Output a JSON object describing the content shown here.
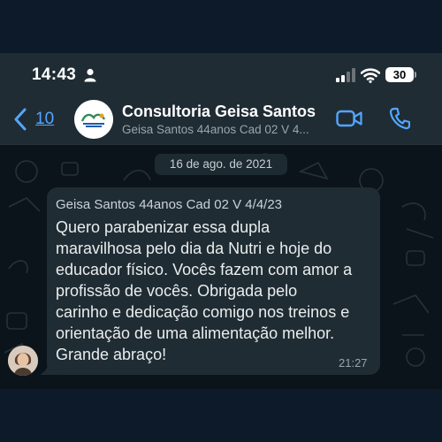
{
  "status_bar": {
    "time": "14:43",
    "battery": "30",
    "icons": [
      "person-icon",
      "signal-icon",
      "wifi-icon",
      "battery-icon"
    ]
  },
  "header": {
    "back_count": "10",
    "contact_name": "Consultoria Geisa Santos",
    "contact_subtitle": "Geisa Santos 44anos Cad 02 V 4...",
    "icons": [
      "back-chevron-icon",
      "group-avatar",
      "video-call-icon",
      "voice-call-icon"
    ]
  },
  "chat": {
    "date": "16 de ago. de 2021",
    "message": {
      "sender": "Geisa Santos 44anos Cad 02 V 4/4/23",
      "lines": [
        "Quero parabenizar essa dupla",
        "maravilhosa pelo dia da Nutri e hoje do",
        "educador físico. Vocês fazem com amor a",
        "profissão de vocês.  Obrigada pelo",
        "carinho e dedicação comigo nos treinos e",
        "orientação de uma alimentação melhor.",
        "Grande abraço!"
      ],
      "time": "21:27"
    }
  },
  "colors": {
    "accent_blue": "#53a6ff",
    "header_bg": "#1f2c34",
    "chat_bg": "#0b141a",
    "bubble_bg": "#202c33"
  }
}
